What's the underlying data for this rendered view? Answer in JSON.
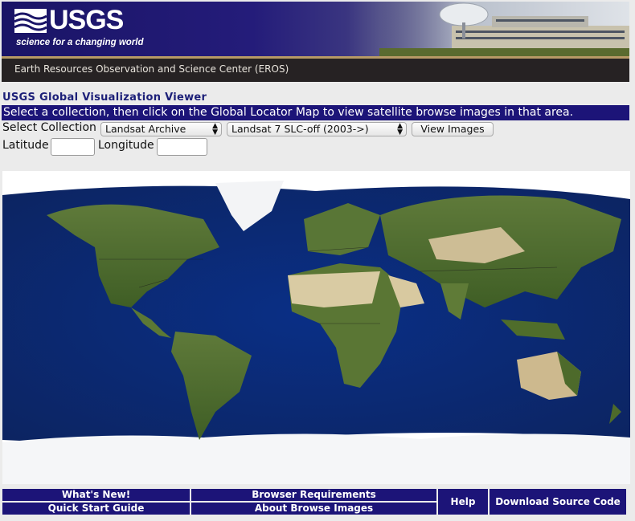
{
  "header": {
    "logo_text": "USGS",
    "logo_tagline": "science for a changing world",
    "center_name": "Earth Resources Observation and Science Center (EROS)"
  },
  "app": {
    "title": "USGS Global Visualization Viewer",
    "instructions": "Select a collection, then click on the Global Locator Map to view satellite browse images in that area."
  },
  "controls": {
    "collection_label": "Select Collection",
    "collection_value": "Landsat Archive",
    "dataset_value": "Landsat 7 SLC-off (2003->)",
    "view_button": "View Images",
    "latitude_label": "Latitude",
    "longitude_label": "Longitude",
    "latitude_value": "",
    "longitude_value": ""
  },
  "footer": {
    "whats_new": "What's New!",
    "quick_start": "Quick Start Guide",
    "browser_req": "Browser Requirements",
    "about_browse": "About Browse Images",
    "help": "Help",
    "download": "Download Source Code"
  },
  "colors": {
    "nav_blue": "#1c1478",
    "ocean": "#0d2a6a",
    "land_green": "#4e6b2c",
    "desert": "#d7c9a2",
    "ice": "#f4f6f8"
  }
}
